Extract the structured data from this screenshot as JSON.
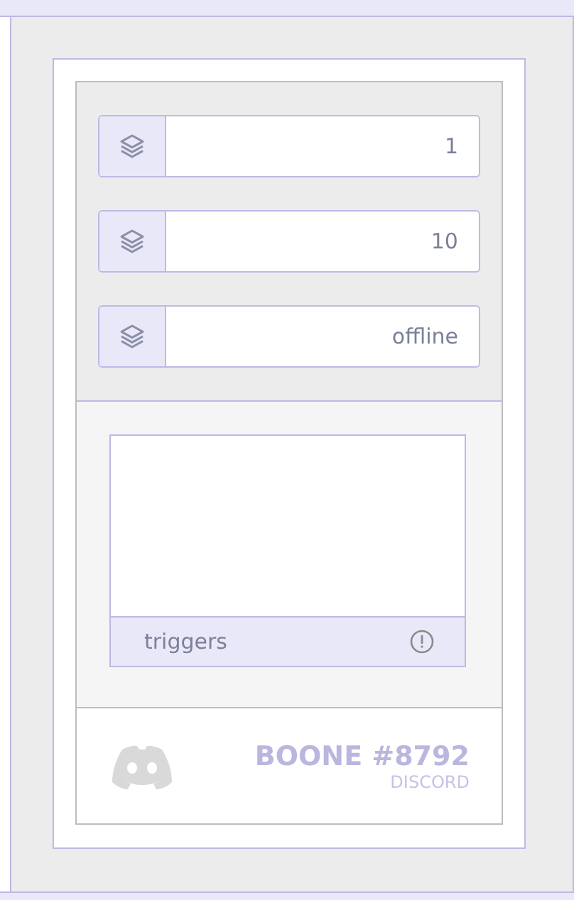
{
  "fields": [
    {
      "value": "1"
    },
    {
      "value": "10"
    },
    {
      "value": "offline"
    }
  ],
  "triggers": {
    "label": "triggers"
  },
  "profile": {
    "name": "BOONE #8792",
    "platform": "DISCORD"
  }
}
